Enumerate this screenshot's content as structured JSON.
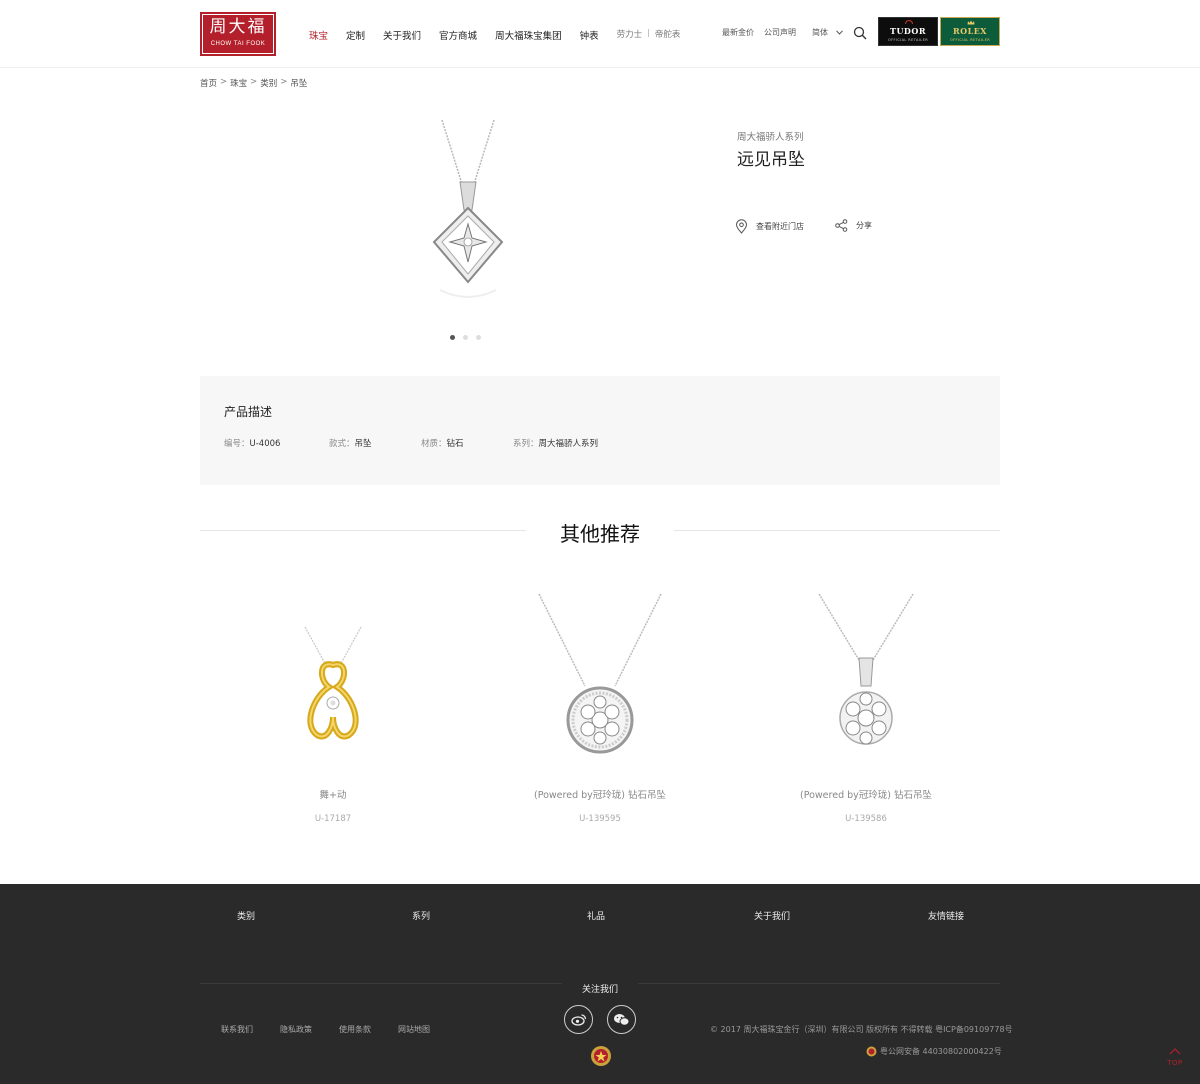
{
  "header": {
    "logo_cn": "周大福",
    "logo_en": "CHOW TAI FOOK",
    "nav": [
      "珠宝",
      "定制",
      "关于我们",
      "官方商城",
      "周大福珠宝集团",
      "钟表"
    ],
    "nav_small": [
      "劳力士",
      "帝舵表"
    ],
    "nav_small_sep": "|",
    "right_links": [
      "最新金价",
      "公司声明"
    ],
    "lang": "简体",
    "tudor": {
      "name": "TUDOR",
      "sub": "OFFICIAL RETAILER"
    },
    "rolex": {
      "name": "ROLEX",
      "sub": "OFFICIAL RETAILER"
    },
    "accent_color": "#b31f2a"
  },
  "breadcrumb": [
    "首页",
    "珠宝",
    "类别",
    "吊坠"
  ],
  "breadcrumb_sep": ">",
  "product": {
    "series": "周大福骄人系列",
    "title": "远见吊坠",
    "actions": {
      "store": "查看附近门店",
      "share": "分享"
    },
    "slide_count": 3,
    "active_slide": 1
  },
  "description": {
    "title": "产品描述",
    "specs": [
      {
        "key": "编号：",
        "value": "U-4006"
      },
      {
        "key": "款式：",
        "value": "吊坠"
      },
      {
        "key": "材质：",
        "value": "钻石"
      },
      {
        "key": "系列：",
        "value": "周大福骄人系列"
      }
    ]
  },
  "recommend": {
    "title": "其他推荐",
    "items": [
      {
        "name": "舞+动",
        "code": "U-17187"
      },
      {
        "name": "(Powered by冠玲珑) 钻石吊坠",
        "code": "U-139595"
      },
      {
        "name": "(Powered by冠玲珑) 钻石吊坠",
        "code": "U-139586"
      }
    ]
  },
  "footer": {
    "columns": [
      "类别",
      "系列",
      "礼品",
      "关于我们",
      "友情链接"
    ],
    "follow": "关注我们",
    "links": [
      "联系我们",
      "隐私政策",
      "使用条款",
      "网站地图"
    ],
    "copyright": "© 2017 周大福珠宝金行（深圳）有限公司 版权所有 不得转载 粤ICP备09109778号",
    "police": "粤公网安备 44030802000422号",
    "top": "TOP",
    "social": [
      "weibo-icon",
      "wechat-icon"
    ]
  }
}
